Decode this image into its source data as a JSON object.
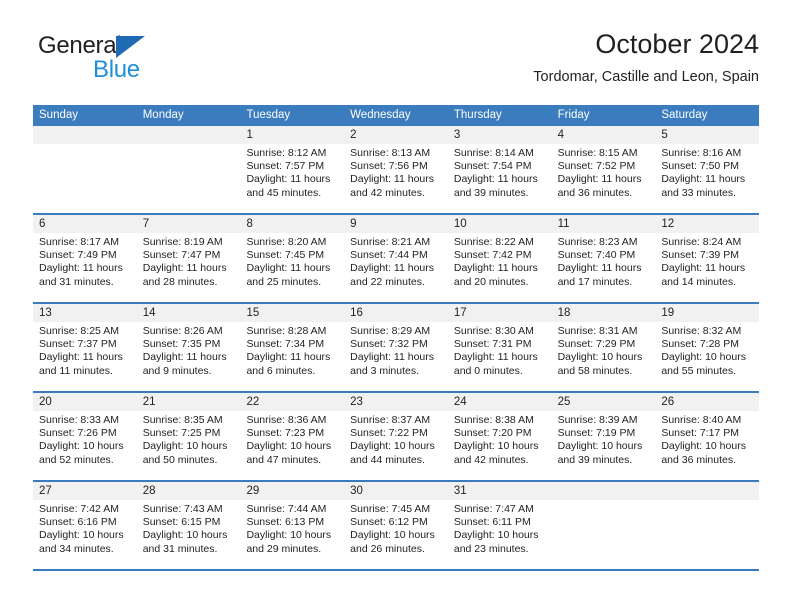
{
  "brand": {
    "name_top": "General",
    "name_bottom": "Blue",
    "triangle_color": "#1f6cb4",
    "top_color": "#231f20",
    "bottom_color": "#1f8fd6",
    "logo_icon": "triangle-icon"
  },
  "header": {
    "title": "October 2024",
    "subtitle": "Tordomar, Castille and Leon, Spain"
  },
  "colors": {
    "header_band": "#3a7cbe",
    "day_band": "#f1f1f1",
    "text": "#231f20",
    "cell_background": "#ffffff"
  },
  "calendar": {
    "weekdays": [
      "Sunday",
      "Monday",
      "Tuesday",
      "Wednesday",
      "Thursday",
      "Friday",
      "Saturday"
    ],
    "weeks": [
      [
        {
          "day": "",
          "lines": []
        },
        {
          "day": "",
          "lines": []
        },
        {
          "day": "1",
          "lines": [
            "Sunrise: 8:12 AM",
            "Sunset: 7:57 PM",
            "Daylight: 11 hours",
            "and 45 minutes."
          ]
        },
        {
          "day": "2",
          "lines": [
            "Sunrise: 8:13 AM",
            "Sunset: 7:56 PM",
            "Daylight: 11 hours",
            "and 42 minutes."
          ]
        },
        {
          "day": "3",
          "lines": [
            "Sunrise: 8:14 AM",
            "Sunset: 7:54 PM",
            "Daylight: 11 hours",
            "and 39 minutes."
          ]
        },
        {
          "day": "4",
          "lines": [
            "Sunrise: 8:15 AM",
            "Sunset: 7:52 PM",
            "Daylight: 11 hours",
            "and 36 minutes."
          ]
        },
        {
          "day": "5",
          "lines": [
            "Sunrise: 8:16 AM",
            "Sunset: 7:50 PM",
            "Daylight: 11 hours",
            "and 33 minutes."
          ]
        }
      ],
      [
        {
          "day": "6",
          "lines": [
            "Sunrise: 8:17 AM",
            "Sunset: 7:49 PM",
            "Daylight: 11 hours",
            "and 31 minutes."
          ]
        },
        {
          "day": "7",
          "lines": [
            "Sunrise: 8:19 AM",
            "Sunset: 7:47 PM",
            "Daylight: 11 hours",
            "and 28 minutes."
          ]
        },
        {
          "day": "8",
          "lines": [
            "Sunrise: 8:20 AM",
            "Sunset: 7:45 PM",
            "Daylight: 11 hours",
            "and 25 minutes."
          ]
        },
        {
          "day": "9",
          "lines": [
            "Sunrise: 8:21 AM",
            "Sunset: 7:44 PM",
            "Daylight: 11 hours",
            "and 22 minutes."
          ]
        },
        {
          "day": "10",
          "lines": [
            "Sunrise: 8:22 AM",
            "Sunset: 7:42 PM",
            "Daylight: 11 hours",
            "and 20 minutes."
          ]
        },
        {
          "day": "11",
          "lines": [
            "Sunrise: 8:23 AM",
            "Sunset: 7:40 PM",
            "Daylight: 11 hours",
            "and 17 minutes."
          ]
        },
        {
          "day": "12",
          "lines": [
            "Sunrise: 8:24 AM",
            "Sunset: 7:39 PM",
            "Daylight: 11 hours",
            "and 14 minutes."
          ]
        }
      ],
      [
        {
          "day": "13",
          "lines": [
            "Sunrise: 8:25 AM",
            "Sunset: 7:37 PM",
            "Daylight: 11 hours",
            "and 11 minutes."
          ]
        },
        {
          "day": "14",
          "lines": [
            "Sunrise: 8:26 AM",
            "Sunset: 7:35 PM",
            "Daylight: 11 hours",
            "and 9 minutes."
          ]
        },
        {
          "day": "15",
          "lines": [
            "Sunrise: 8:28 AM",
            "Sunset: 7:34 PM",
            "Daylight: 11 hours",
            "and 6 minutes."
          ]
        },
        {
          "day": "16",
          "lines": [
            "Sunrise: 8:29 AM",
            "Sunset: 7:32 PM",
            "Daylight: 11 hours",
            "and 3 minutes."
          ]
        },
        {
          "day": "17",
          "lines": [
            "Sunrise: 8:30 AM",
            "Sunset: 7:31 PM",
            "Daylight: 11 hours",
            "and 0 minutes."
          ]
        },
        {
          "day": "18",
          "lines": [
            "Sunrise: 8:31 AM",
            "Sunset: 7:29 PM",
            "Daylight: 10 hours",
            "and 58 minutes."
          ]
        },
        {
          "day": "19",
          "lines": [
            "Sunrise: 8:32 AM",
            "Sunset: 7:28 PM",
            "Daylight: 10 hours",
            "and 55 minutes."
          ]
        }
      ],
      [
        {
          "day": "20",
          "lines": [
            "Sunrise: 8:33 AM",
            "Sunset: 7:26 PM",
            "Daylight: 10 hours",
            "and 52 minutes."
          ]
        },
        {
          "day": "21",
          "lines": [
            "Sunrise: 8:35 AM",
            "Sunset: 7:25 PM",
            "Daylight: 10 hours",
            "and 50 minutes."
          ]
        },
        {
          "day": "22",
          "lines": [
            "Sunrise: 8:36 AM",
            "Sunset: 7:23 PM",
            "Daylight: 10 hours",
            "and 47 minutes."
          ]
        },
        {
          "day": "23",
          "lines": [
            "Sunrise: 8:37 AM",
            "Sunset: 7:22 PM",
            "Daylight: 10 hours",
            "and 44 minutes."
          ]
        },
        {
          "day": "24",
          "lines": [
            "Sunrise: 8:38 AM",
            "Sunset: 7:20 PM",
            "Daylight: 10 hours",
            "and 42 minutes."
          ]
        },
        {
          "day": "25",
          "lines": [
            "Sunrise: 8:39 AM",
            "Sunset: 7:19 PM",
            "Daylight: 10 hours",
            "and 39 minutes."
          ]
        },
        {
          "day": "26",
          "lines": [
            "Sunrise: 8:40 AM",
            "Sunset: 7:17 PM",
            "Daylight: 10 hours",
            "and 36 minutes."
          ]
        }
      ],
      [
        {
          "day": "27",
          "lines": [
            "Sunrise: 7:42 AM",
            "Sunset: 6:16 PM",
            "Daylight: 10 hours",
            "and 34 minutes."
          ]
        },
        {
          "day": "28",
          "lines": [
            "Sunrise: 7:43 AM",
            "Sunset: 6:15 PM",
            "Daylight: 10 hours",
            "and 31 minutes."
          ]
        },
        {
          "day": "29",
          "lines": [
            "Sunrise: 7:44 AM",
            "Sunset: 6:13 PM",
            "Daylight: 10 hours",
            "and 29 minutes."
          ]
        },
        {
          "day": "30",
          "lines": [
            "Sunrise: 7:45 AM",
            "Sunset: 6:12 PM",
            "Daylight: 10 hours",
            "and 26 minutes."
          ]
        },
        {
          "day": "31",
          "lines": [
            "Sunrise: 7:47 AM",
            "Sunset: 6:11 PM",
            "Daylight: 10 hours",
            "and 23 minutes."
          ]
        },
        {
          "day": "",
          "lines": []
        },
        {
          "day": "",
          "lines": []
        }
      ]
    ]
  }
}
